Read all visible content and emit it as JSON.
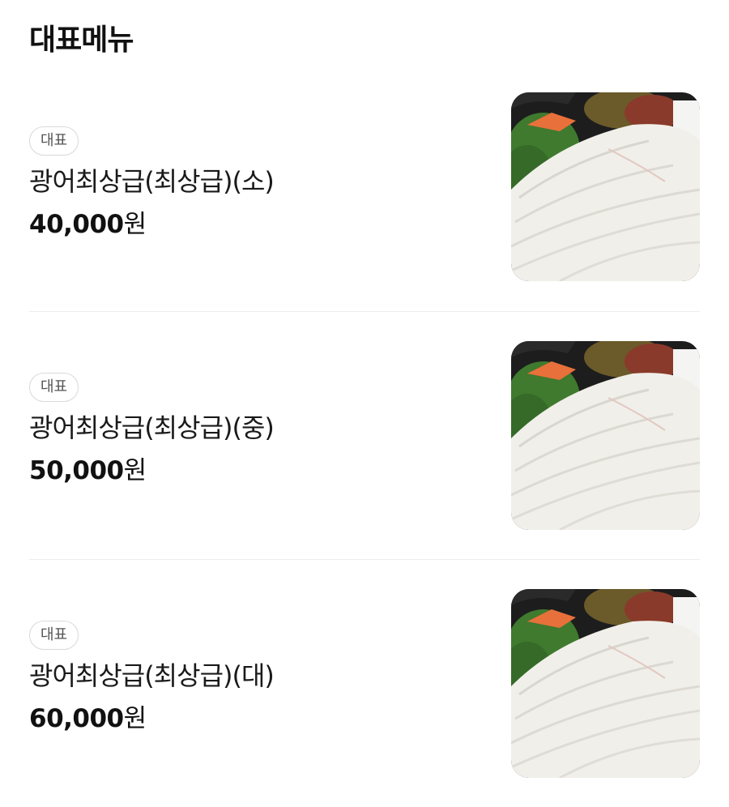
{
  "section": {
    "title": "대표메뉴"
  },
  "menu": {
    "items": [
      {
        "badge": "대표",
        "name": "광어최상급(최상급)(소)",
        "price_value": "40,000",
        "price_unit": "원",
        "image_alt": "sliced flounder sashimi plate"
      },
      {
        "badge": "대표",
        "name": "광어최상급(최상급)(중)",
        "price_value": "50,000",
        "price_unit": "원",
        "image_alt": "sliced flounder sashimi plate"
      },
      {
        "badge": "대표",
        "name": "광어최상급(최상급)(대)",
        "price_value": "60,000",
        "price_unit": "원",
        "image_alt": "sliced flounder sashimi plate"
      }
    ]
  },
  "colors": {
    "text": "#111111",
    "badge_border": "#d9d9d9",
    "divider": "#ececec",
    "sashimi": "#f1efe9",
    "garnish_green": "#3f7a2e",
    "carrot": "#e8703a"
  }
}
